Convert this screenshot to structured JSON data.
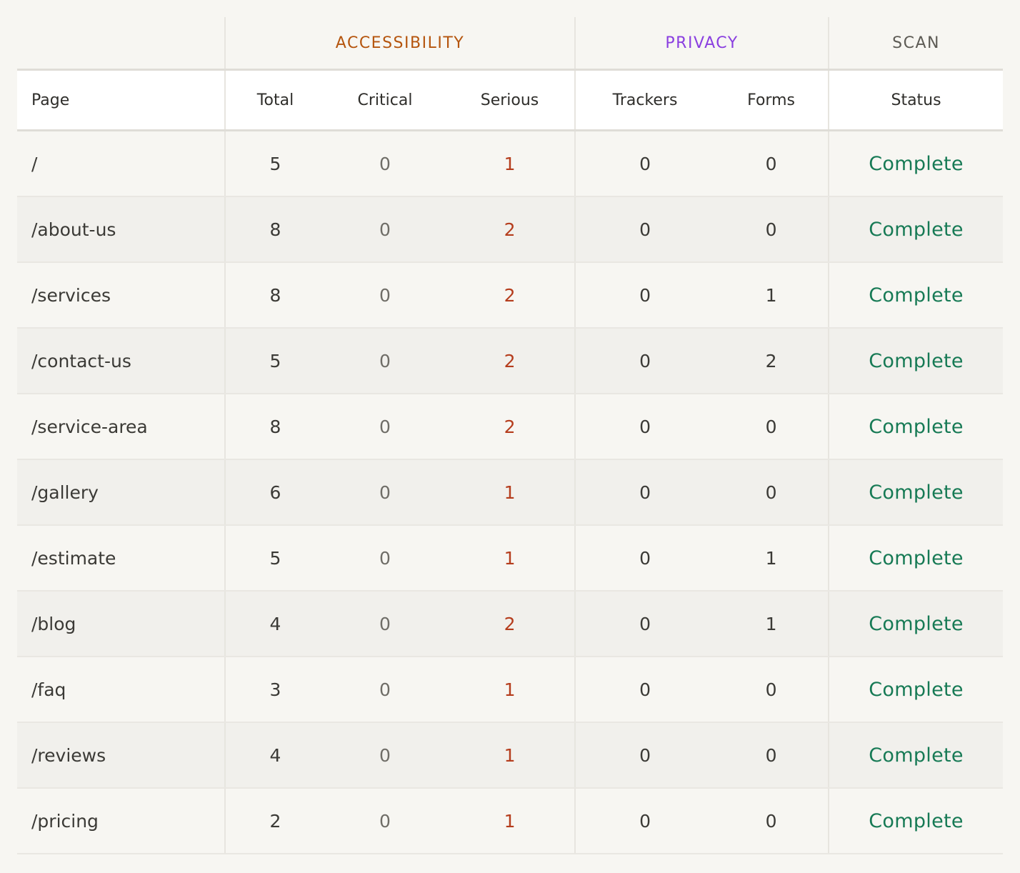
{
  "groups": {
    "accessibility": {
      "label": "ACCESSIBILITY",
      "color": "#b5550e"
    },
    "privacy": {
      "label": "PRIVACY",
      "color": "#8a3fe0"
    },
    "scan": {
      "label": "SCAN",
      "color": "#5d5b55"
    }
  },
  "columns": {
    "page": "Page",
    "total": "Total",
    "critical": "Critical",
    "serious": "Serious",
    "trackers": "Trackers",
    "forms": "Forms",
    "status": "Status"
  },
  "colors": {
    "serious": "#b53d1d",
    "status_complete": "#177a55"
  },
  "rows": [
    {
      "page": "/",
      "total": "5",
      "critical": "0",
      "serious": "1",
      "trackers": "0",
      "forms": "0",
      "status": "Complete"
    },
    {
      "page": "/about-us",
      "total": "8",
      "critical": "0",
      "serious": "2",
      "trackers": "0",
      "forms": "0",
      "status": "Complete"
    },
    {
      "page": "/services",
      "total": "8",
      "critical": "0",
      "serious": "2",
      "trackers": "0",
      "forms": "1",
      "status": "Complete"
    },
    {
      "page": "/contact-us",
      "total": "5",
      "critical": "0",
      "serious": "2",
      "trackers": "0",
      "forms": "2",
      "status": "Complete"
    },
    {
      "page": "/service-area",
      "total": "8",
      "critical": "0",
      "serious": "2",
      "trackers": "0",
      "forms": "0",
      "status": "Complete"
    },
    {
      "page": "/gallery",
      "total": "6",
      "critical": "0",
      "serious": "1",
      "trackers": "0",
      "forms": "0",
      "status": "Complete"
    },
    {
      "page": "/estimate",
      "total": "5",
      "critical": "0",
      "serious": "1",
      "trackers": "0",
      "forms": "1",
      "status": "Complete"
    },
    {
      "page": "/blog",
      "total": "4",
      "critical": "0",
      "serious": "2",
      "trackers": "0",
      "forms": "1",
      "status": "Complete"
    },
    {
      "page": "/faq",
      "total": "3",
      "critical": "0",
      "serious": "1",
      "trackers": "0",
      "forms": "0",
      "status": "Complete"
    },
    {
      "page": "/reviews",
      "total": "4",
      "critical": "0",
      "serious": "1",
      "trackers": "0",
      "forms": "0",
      "status": "Complete"
    },
    {
      "page": "/pricing",
      "total": "2",
      "critical": "0",
      "serious": "1",
      "trackers": "0",
      "forms": "0",
      "status": "Complete"
    }
  ]
}
